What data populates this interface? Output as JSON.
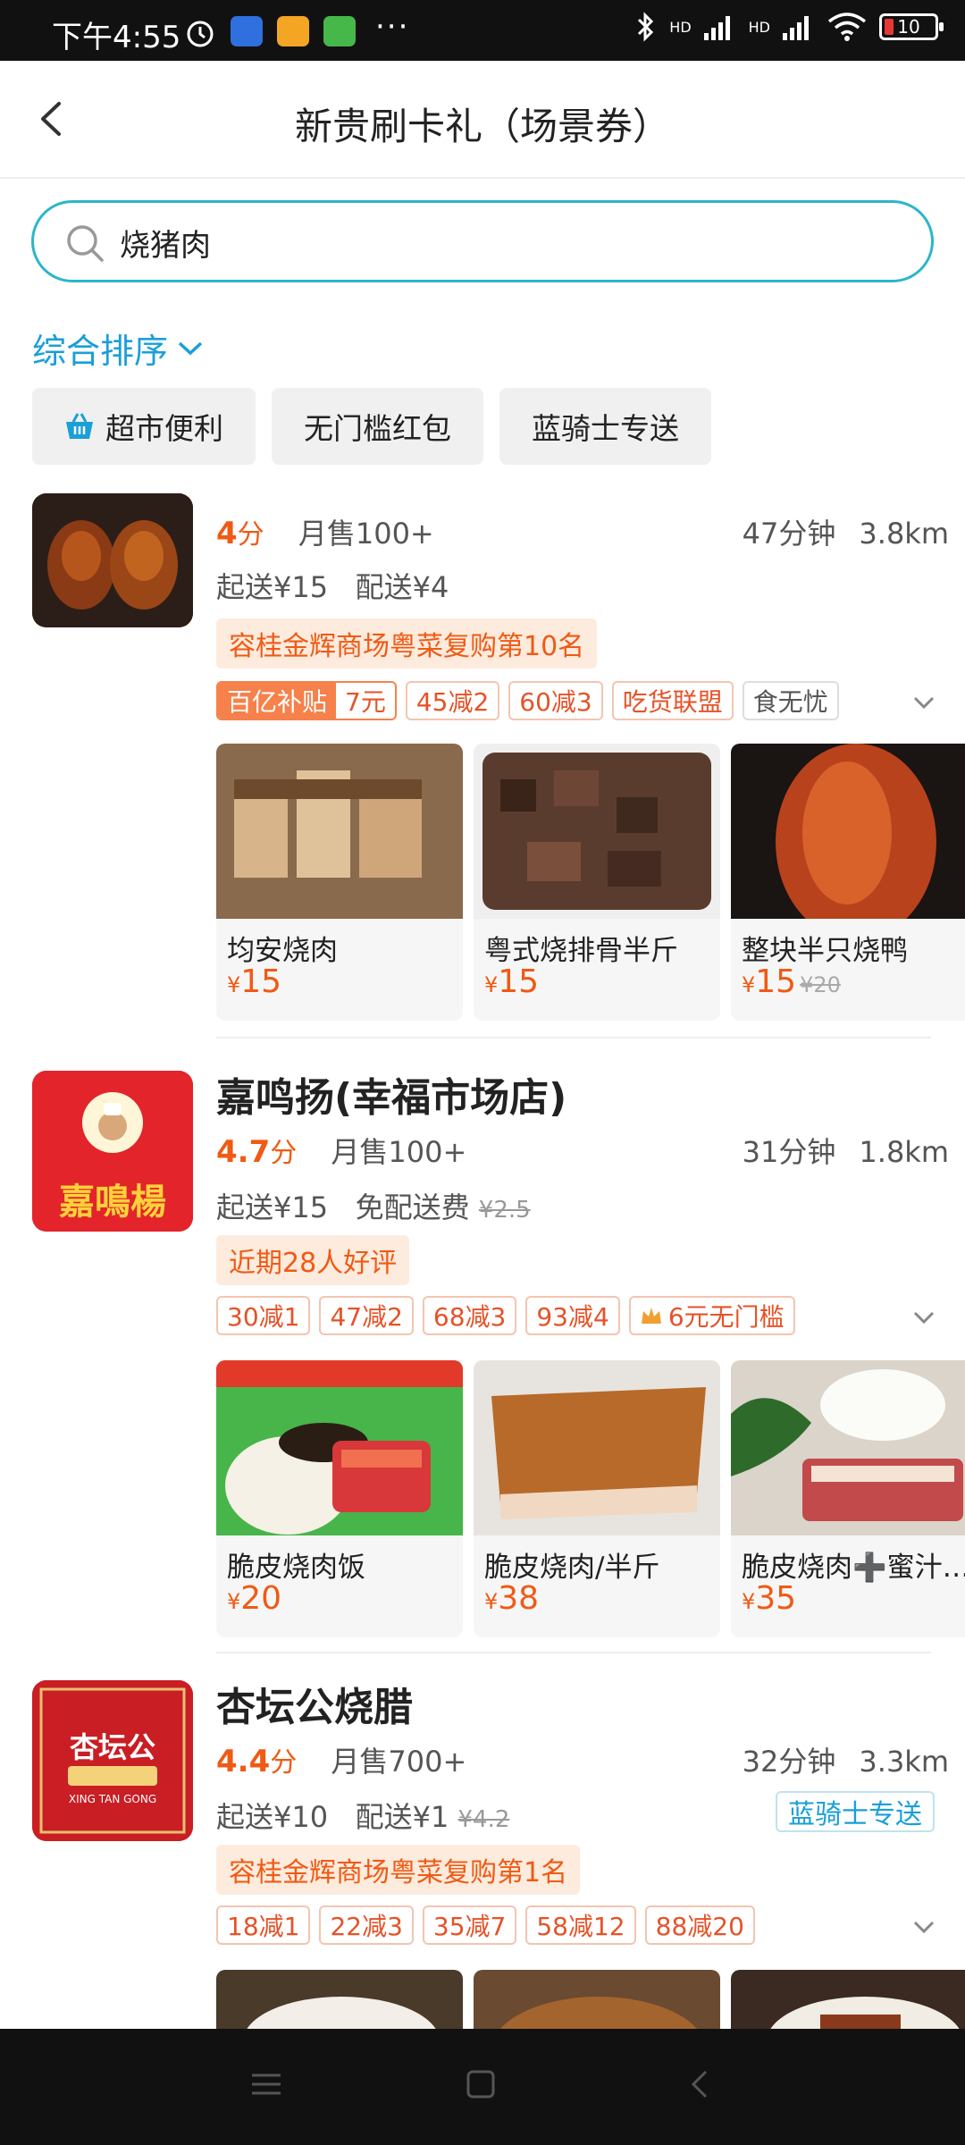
{
  "status_bar": {
    "time": "下午4:55",
    "dots": "···",
    "hd1": "HD",
    "hd2": "HD",
    "battery": "10"
  },
  "header": {
    "title": "新贵刷卡礼（场景券）"
  },
  "search": {
    "value": "烧猪肉",
    "placeholder": ""
  },
  "sort": {
    "label": "综合排序"
  },
  "filters": [
    {
      "label": "超市便利",
      "icon": "basket-icon"
    },
    {
      "label": "无门槛红包"
    },
    {
      "label": "蓝骑士专送"
    }
  ],
  "stores": [
    {
      "name": "",
      "rating": "4",
      "rating_unit": "分",
      "monthly": "月售100+",
      "eta": "47分钟",
      "distance": "3.8km",
      "min_order": "起送¥15",
      "delivery": "配送¥4",
      "delivery_old": "",
      "rank": "容桂金辉商场粤菜复购第10名",
      "subsidy": {
        "a": "百亿补贴",
        "b": "7元"
      },
      "tags": [
        "45减2",
        "60减3",
        "吃货联盟",
        "食无忧"
      ],
      "items": [
        {
          "name": "均安烧肉",
          "currency": "¥",
          "price": "15",
          "old": ""
        },
        {
          "name": "粤式烧排骨半斤",
          "currency": "¥",
          "price": "15",
          "old": ""
        },
        {
          "name": "整块半只烧鸭",
          "currency": "¥",
          "price": "15",
          "old": "¥20"
        }
      ]
    },
    {
      "name": "嘉鸣扬(幸福市场店)",
      "logo_text": "嘉鳴楊",
      "rating": "4.7",
      "rating_unit": "分",
      "monthly": "月售100+",
      "eta": "31分钟",
      "distance": "1.8km",
      "min_order": "起送¥15",
      "delivery": "免配送费",
      "delivery_old": "¥2.5",
      "rank": "近期28人好评",
      "tags": [
        "30减1",
        "47减2",
        "68减3",
        "93减4",
        "6元无门槛"
      ],
      "items": [
        {
          "name": "脆皮烧肉饭",
          "currency": "¥",
          "price": "20",
          "old": ""
        },
        {
          "name": "脆皮烧肉/半斤",
          "currency": "¥",
          "price": "38",
          "old": ""
        },
        {
          "name": "脆皮烧肉➕蜜汁…",
          "currency": "¥",
          "price": "35",
          "old": ""
        }
      ]
    },
    {
      "name": "杏坛公烧腊",
      "logo_text": "杏坛公",
      "logo_sub": "XING TAN GONG",
      "rating": "4.4",
      "rating_unit": "分",
      "monthly": "月售700+",
      "eta": "32分钟",
      "distance": "3.3km",
      "min_order": "起送¥10",
      "delivery": "配送¥1",
      "delivery_old": "¥4.2",
      "rider": "蓝骑士专送",
      "rank": "容桂金辉商场粤菜复购第1名",
      "tags": [
        "18减1",
        "22减3",
        "35减7",
        "58减12",
        "88减20"
      ]
    }
  ],
  "colors": {
    "accent": "#1a9fd8",
    "price": "#f05a14",
    "search_border": "#2bb6c8"
  }
}
